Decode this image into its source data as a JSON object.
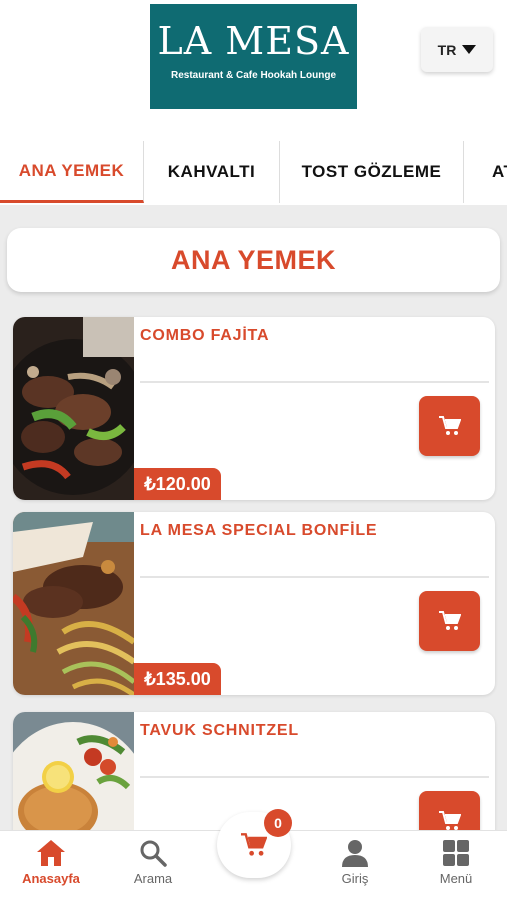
{
  "header": {
    "logo_title": "LA MESA",
    "logo_subtitle": "Restaurant & Cafe Hookah Lounge",
    "language": "TR"
  },
  "tabs": [
    {
      "label": "ANA YEMEK",
      "active": true
    },
    {
      "label": "KAHVALTI",
      "active": false
    },
    {
      "label": "TOST GÖZLEME",
      "active": false
    },
    {
      "label": "AT",
      "active": false
    }
  ],
  "section": {
    "title": "ANA YEMEK"
  },
  "products": [
    {
      "name": "COMBO FAJİTA",
      "price": "₺120.00",
      "image": "fajita-photo"
    },
    {
      "name": "LA MESA SPECIAL BONFİLE",
      "price": "₺135.00",
      "image": "bonfile-photo"
    },
    {
      "name": "TAVUK SCHNITZEL",
      "price": "",
      "image": "schnitzel-photo"
    }
  ],
  "bottom_nav": {
    "home": "Anasayfa",
    "search": "Arama",
    "cart_count": "0",
    "login": "Giriş",
    "menu": "Menü"
  },
  "colors": {
    "accent": "#d84a2c",
    "logo_bg": "#0f6b72",
    "content_bg": "#ececec"
  }
}
